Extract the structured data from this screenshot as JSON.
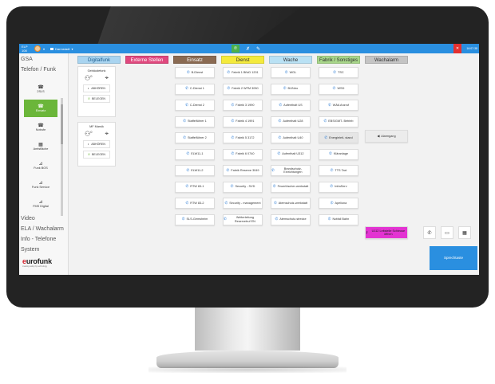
{
  "topbar": {
    "user_id": "ELP 108",
    "site": "Darmstadt",
    "time": "16:07:38",
    "center_icons": [
      "phone-in-icon",
      "phone-off-icon",
      "phone-transfer-icon"
    ]
  },
  "sidebar": {
    "menu_top": [
      {
        "label": "GSA"
      },
      {
        "label": "Telefon / Funk"
      }
    ],
    "sub_items": [
      {
        "label": "2SLS",
        "icon": "phone-icon"
      },
      {
        "label": "Einsatz",
        "icon": "phone-icon",
        "active": true
      },
      {
        "label": "Notrufe",
        "icon": "phone-icon"
      },
      {
        "label": "Amtsfläche",
        "icon": "grid-icon"
      },
      {
        "label": "Funk BOS",
        "icon": "radio-icon"
      },
      {
        "label": "Funk Service",
        "icon": "radio-icon"
      },
      {
        "label": "FMS Digital",
        "icon": "radio-icon"
      }
    ],
    "menu_bottom": [
      {
        "label": "Video"
      },
      {
        "label": "ELA / Wachalarm"
      },
      {
        "label": "Info - Telefone"
      },
      {
        "label": "System"
      }
    ],
    "logo": {
      "word_first": "e",
      "word_rest": "urofunk",
      "tagline": "creating safety by technology"
    }
  },
  "columns": [
    {
      "label": "Digitalfunk",
      "color": "#a9d4f0"
    },
    {
      "label": "Externe Stellen",
      "color": "#e0487e"
    },
    {
      "label": "Einsatz",
      "color": "#8a6a52"
    },
    {
      "label": "Dienst",
      "color": "#f4ea3c"
    },
    {
      "label": "Wache",
      "color": "#b9e1f4"
    },
    {
      "label": "Fabrik / Sonstiges",
      "color": "#a8d68a"
    },
    {
      "label": "Wachalarm",
      "color": "#c4c4c4"
    }
  ],
  "radio_cards": [
    {
      "title": "Gebäudefunk",
      "count": "0",
      "buttons": [
        "ABHÖREN",
        "BELEGEN"
      ]
    },
    {
      "title": "MF Marsik",
      "count": "0",
      "buttons": [
        "ABHÖREN",
        "BELEGEN"
      ]
    }
  ],
  "grid": {
    "einsatz": [
      "B-Dienst",
      "C-Dienst 1",
      "C-Dienst 2",
      "Staffelführer 1",
      "Staffelführer 2",
      "ELW11-1",
      "ELW11-2",
      "RTW 83-1",
      "RTW 83-2",
      "SLS-Gemsheim"
    ],
    "dienst": [
      "Fabrik 1 BfIvD 1201",
      "Fabrik 2 WFM 3050",
      "Fabrik 3 1990",
      "Fabrik 4 1991",
      "Fabrik 5 3172",
      "Fabrik 6 0740",
      "Fabrik Reserve 3049",
      "Security - SVD",
      "Security - management",
      "Weiterleitung Reservetruf EN"
    ],
    "wache": [
      "WGL",
      "Bl-Büro",
      "Aufenthalt US",
      "Aufenthalt U28",
      "Aufenthalt U40",
      "Aufenthalt U312",
      "Brandschutz-Einrichtungen",
      "Feuerlöscher-werkstatt",
      "Atemschutz-werkstatt",
      "Atemschutz-strecke"
    ],
    "fabrik": [
      "TSC",
      "WSD",
      "WÄA Anzruf",
      "EBS/GMT- Betrieb",
      "Energieleit- stand",
      "Kläranlage",
      "TTS Taxi",
      "InfraServ",
      "Apeliona",
      "Notfall Bahn"
    ],
    "wachalarm": {
      "label": "Alarmgang"
    },
    "special": {
      "label": "U112 Leitstelle Schleuse öffnen"
    }
  },
  "right_controls": {
    "buttons": [
      "phone-icon",
      "monitor-icon",
      "grid-icon"
    ],
    "speak_label": "Sprechtaste"
  }
}
